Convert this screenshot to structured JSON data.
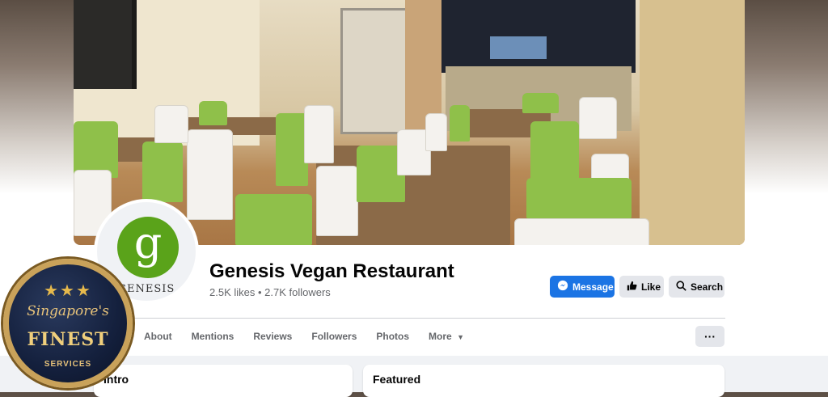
{
  "page": {
    "name": "Genesis Vegan Restaurant",
    "stats": "2.5K likes • 2.7K followers",
    "logo_letter": "g",
    "logo_text": "GENESIS"
  },
  "actions": {
    "message_label": "Message",
    "like_label": "Like",
    "search_label": "Search",
    "more_label": "···"
  },
  "tabs": [
    {
      "label": "About"
    },
    {
      "label": "Mentions"
    },
    {
      "label": "Reviews"
    },
    {
      "label": "Followers"
    },
    {
      "label": "Photos"
    },
    {
      "label": "More"
    }
  ],
  "cards": {
    "intro_title": "Intro",
    "featured_title": "Featured"
  },
  "badge": {
    "stars": "★★★",
    "line1": "Singapore's",
    "line2": "FINEST",
    "line3": "SERVICES"
  },
  "colors": {
    "primary": "#1b74e4",
    "logo_green": "#5aa31a",
    "badge_gold": "#c9a25a"
  }
}
